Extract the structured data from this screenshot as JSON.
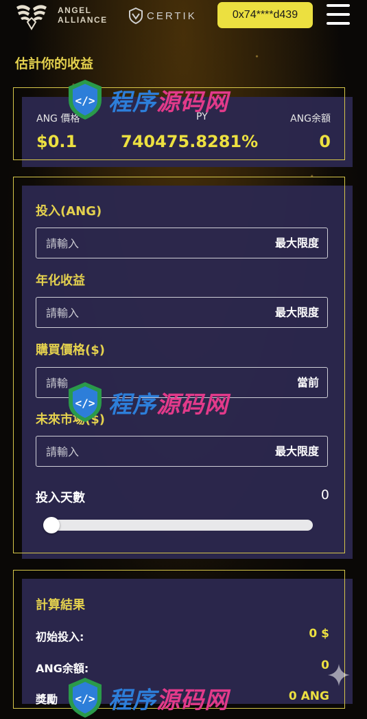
{
  "header": {
    "logo_line1": "ANGEL",
    "logo_line2": "ALLIANCE",
    "partner_label": "CERTIK",
    "wallet_address": "0x74****d439"
  },
  "title": "估計你的收益",
  "stats": {
    "price_label": "ANG 價格",
    "price_value": "$0.1",
    "apy_label": "PY",
    "apy_value": "740475.8281%",
    "balance_label": "ANG余額",
    "balance_value": "0"
  },
  "form": {
    "investment_label": "投入(ANG)",
    "investment_placeholder": "請輸入",
    "investment_suffix": "最大限度",
    "annual_label": "年化收益",
    "annual_placeholder": "請輸入",
    "annual_suffix": "最大限度",
    "buy_price_label": "購買價格($)",
    "buy_price_placeholder": "請輸",
    "buy_price_suffix": "當前",
    "future_price_label": "未來市場($)",
    "future_price_placeholder": "請輸入",
    "future_price_suffix": "最大限度",
    "days_label": "投入天數",
    "days_value": "0"
  },
  "results": {
    "title": "計算結果",
    "initial_label": "初始投入:",
    "initial_value": "0 $",
    "balance_label": "ANG余額:",
    "balance_value": "0",
    "reward_label": "獎勵",
    "reward_value": "0 ANG"
  },
  "watermark": {
    "text_a": "程序",
    "text_b": "源码网"
  },
  "colors": {
    "accent_yellow": "#ece040",
    "label_gold": "#e4d14e",
    "card_bg": "#2c284e"
  }
}
